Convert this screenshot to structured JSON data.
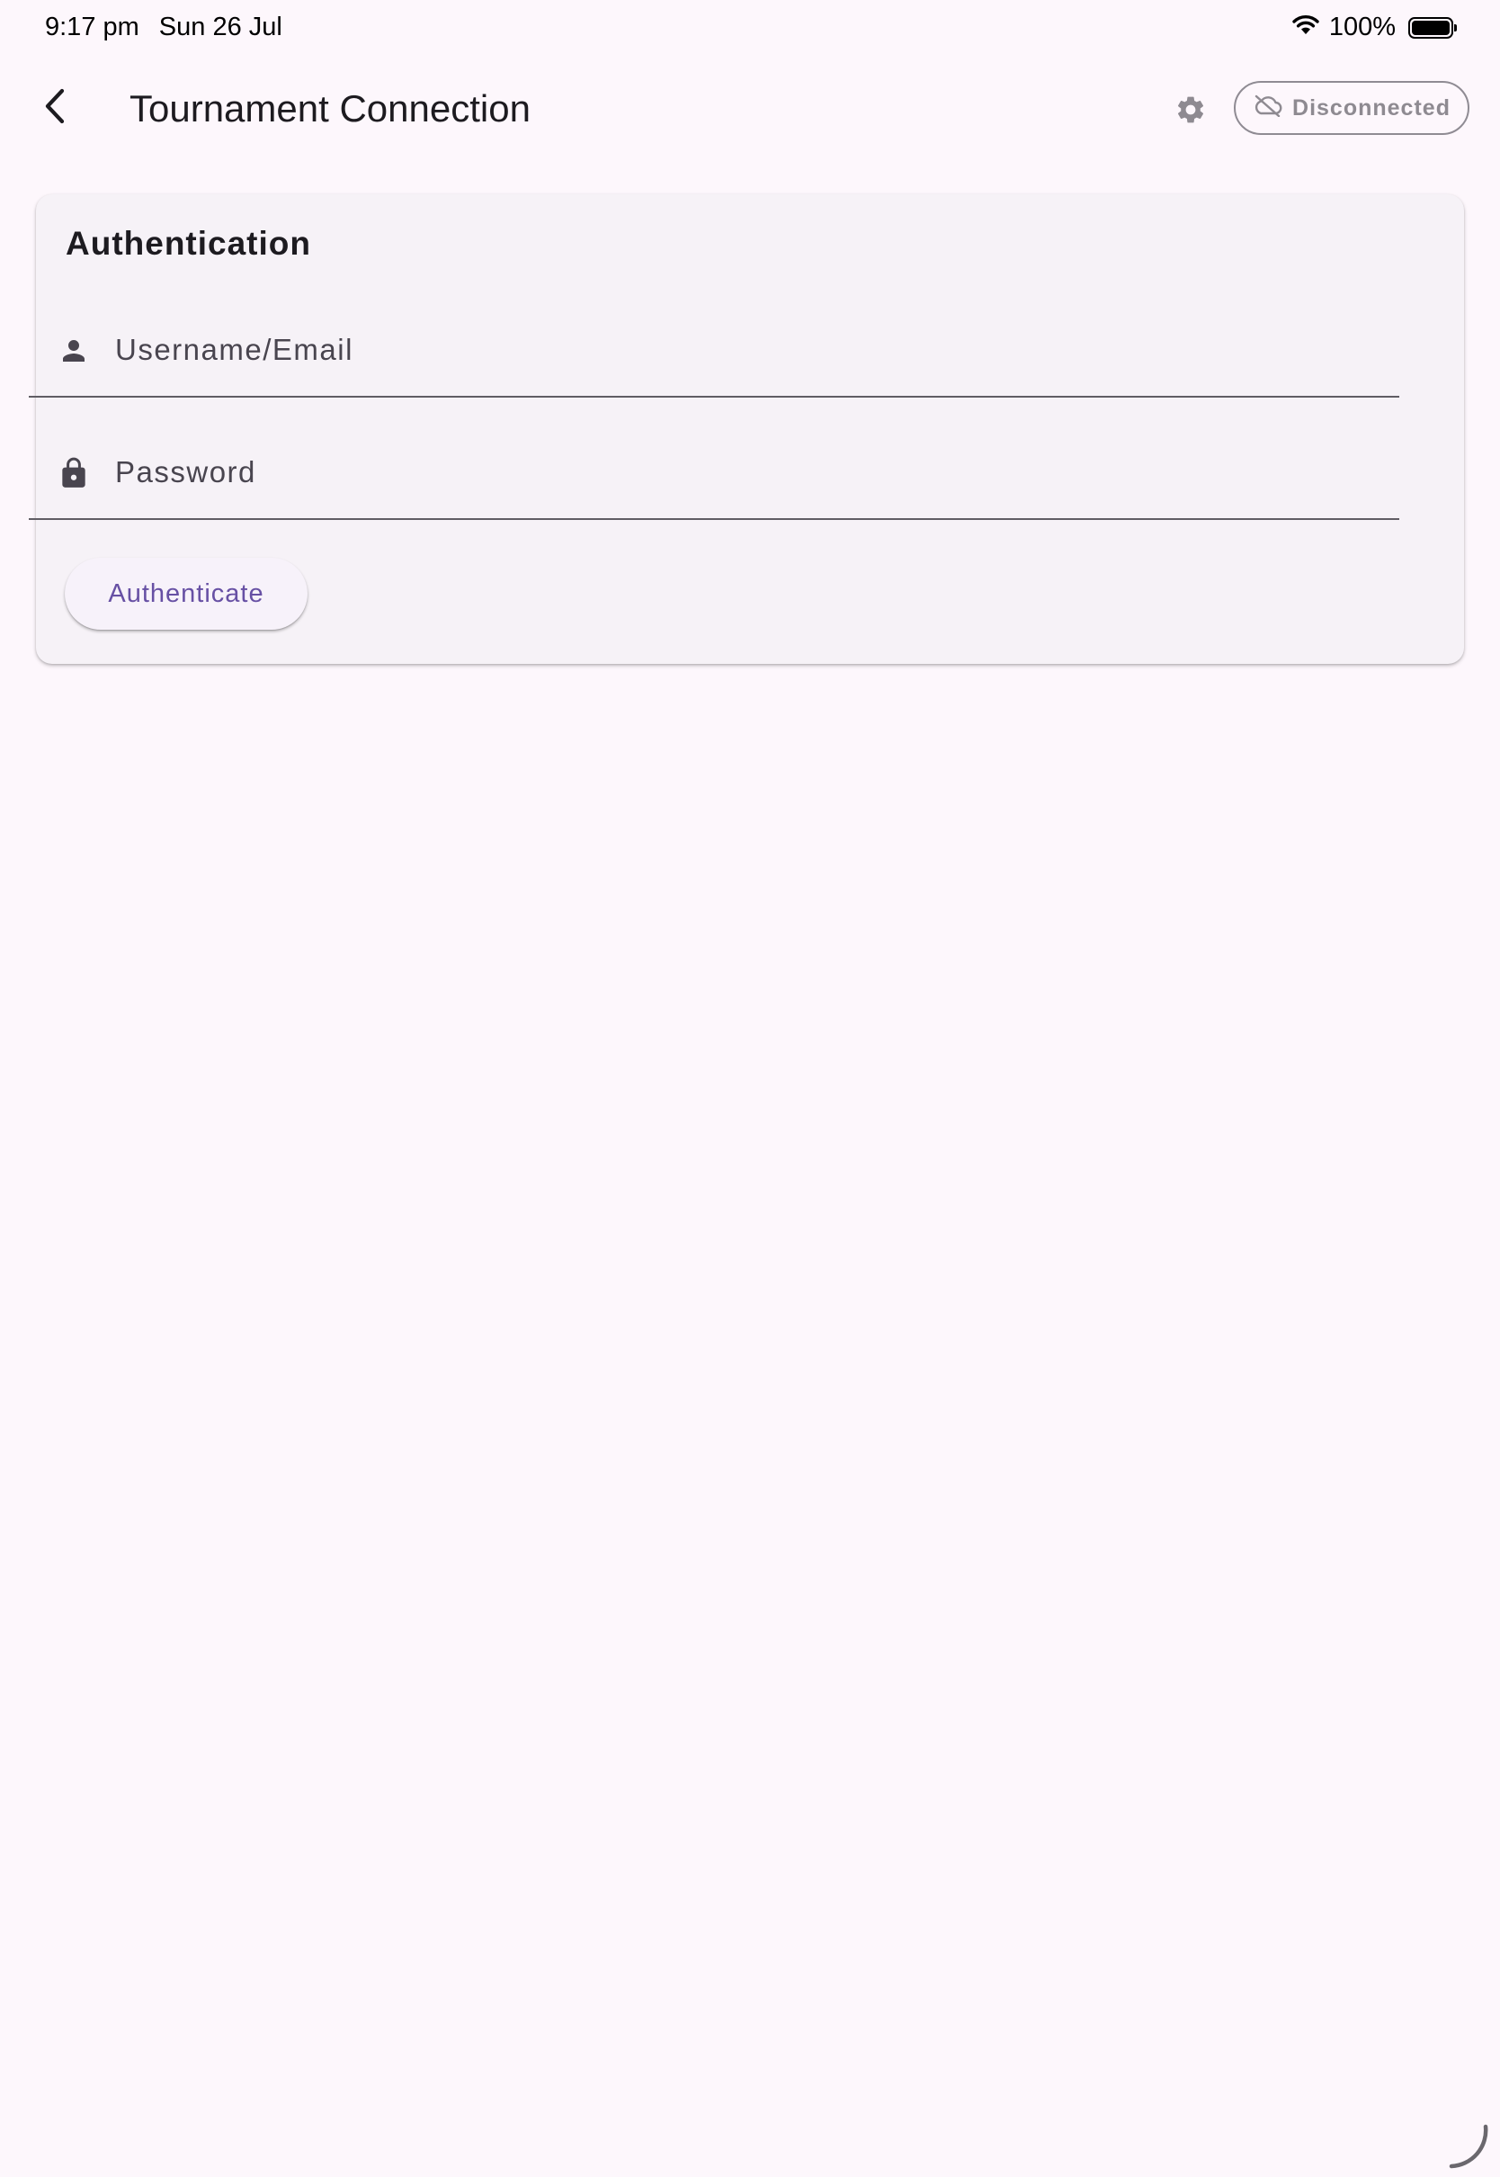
{
  "status_bar": {
    "time": "9:17 pm",
    "date": "Sun 26 Jul",
    "battery": "100%",
    "battery_level": 1.0,
    "icons": [
      "wifi-icon",
      "battery-icon"
    ]
  },
  "app_bar": {
    "title": "Tournament Connection",
    "back_icon": "chevron-left-icon",
    "settings_icon": "gear-icon",
    "connection_status": {
      "label": "Disconnected",
      "icon": "cloud-off-icon"
    }
  },
  "auth_card": {
    "title": "Authentication",
    "username": {
      "placeholder": "Username/Email",
      "value": "",
      "icon": "person-icon"
    },
    "password": {
      "placeholder": "Password",
      "value": "",
      "icon": "lock-icon"
    },
    "submit_label": "Authenticate"
  },
  "colors": {
    "background": "#fdf7fc",
    "card": "#f6f2f7",
    "primary": "#6750a4",
    "text": "#1d1b20",
    "muted": "#8e8a91",
    "icon": "#49454f"
  }
}
